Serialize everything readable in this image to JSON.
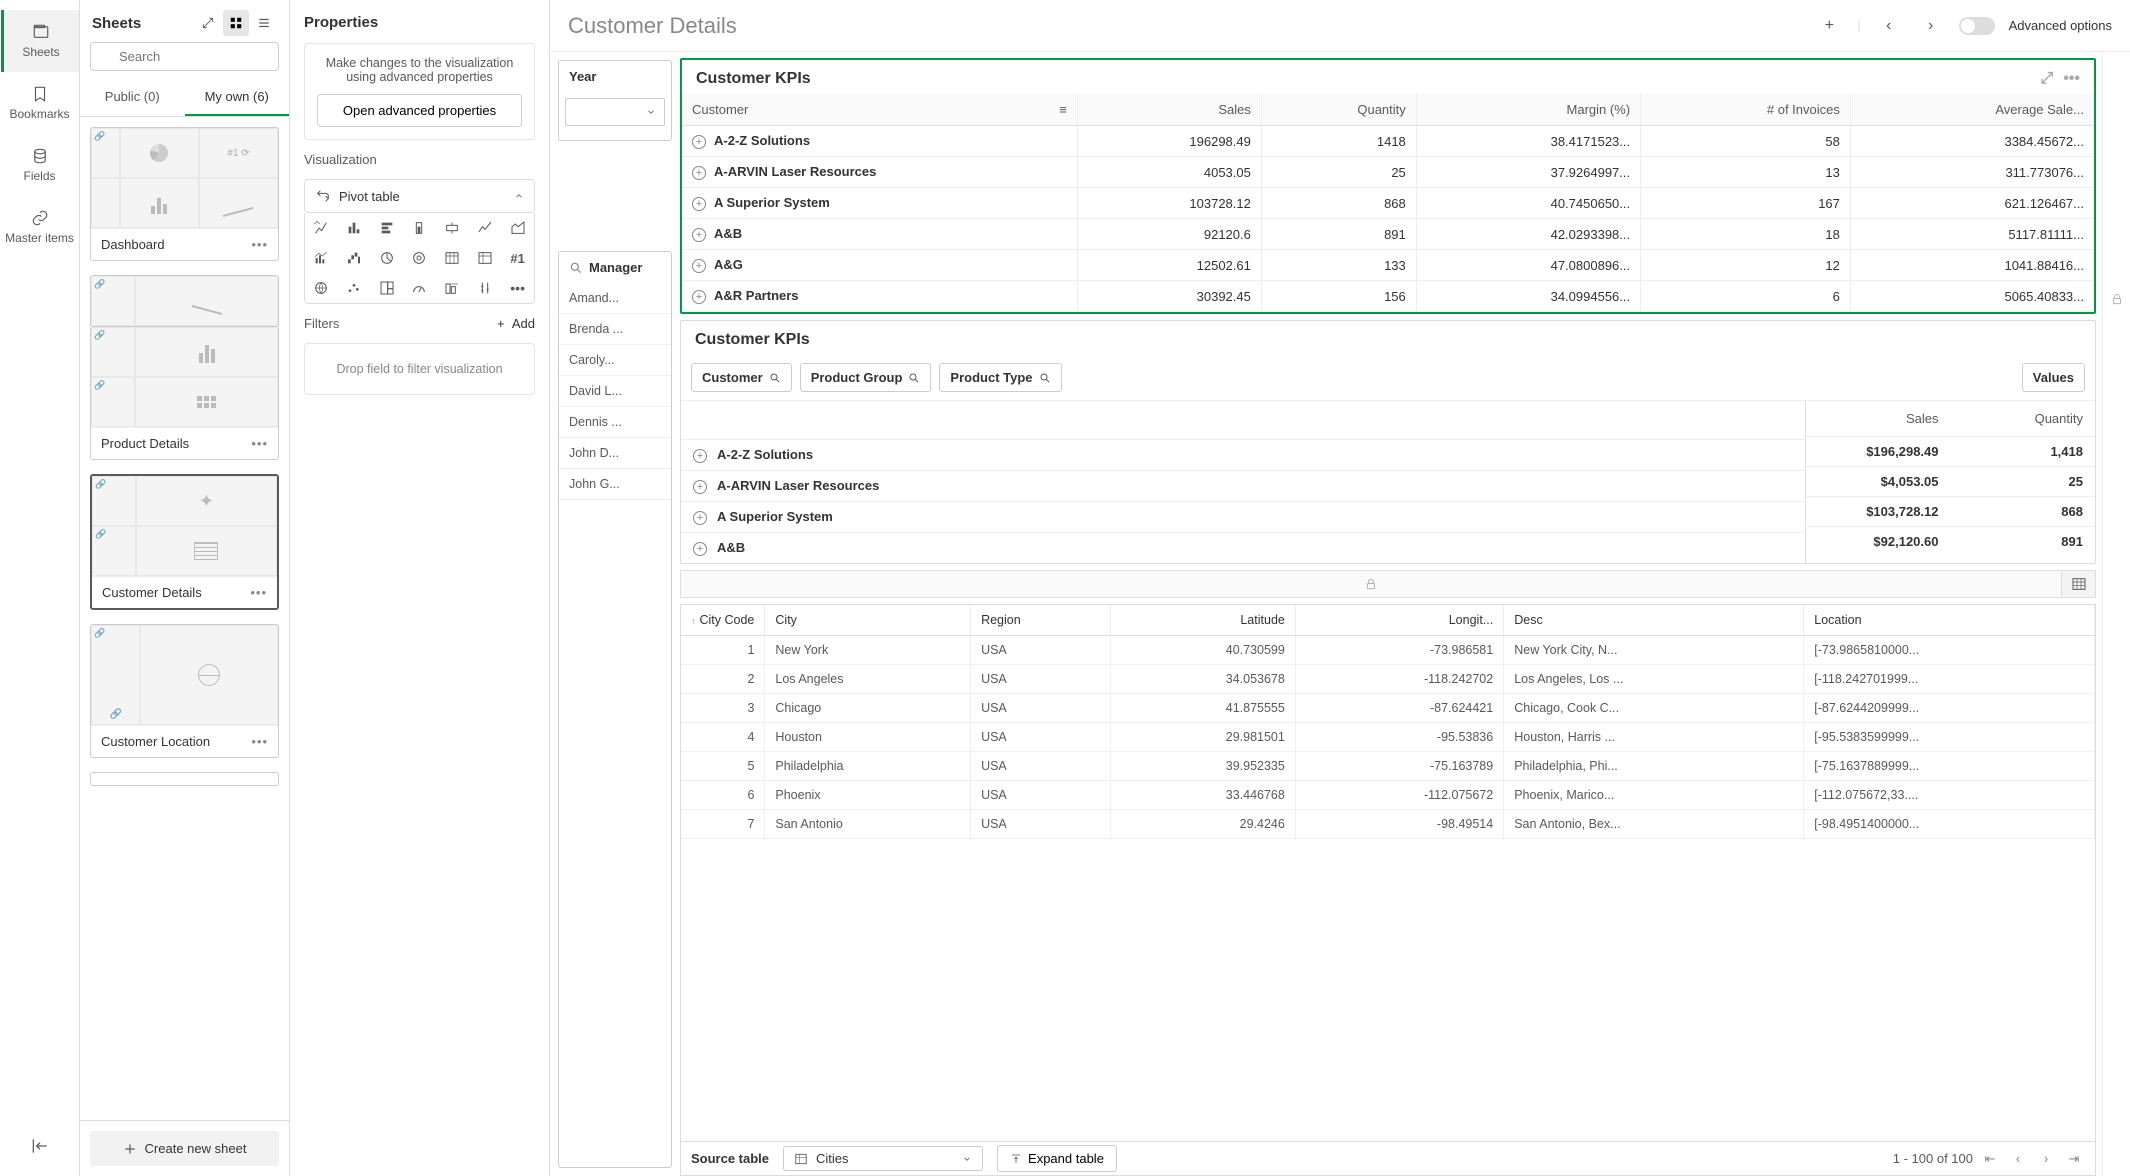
{
  "rail": {
    "sheets": "Sheets",
    "bookmarks": "Bookmarks",
    "fields": "Fields",
    "master": "Master items"
  },
  "sheets": {
    "title": "Sheets",
    "searchPlaceholder": "Search",
    "tabs": {
      "public": "Public (0)",
      "myown": "My own (6)"
    },
    "items": [
      {
        "name": "Dashboard"
      },
      {
        "name": "Product Details"
      },
      {
        "name": "Customer Details"
      },
      {
        "name": "Customer Location"
      }
    ],
    "createLabel": "Create new sheet"
  },
  "props": {
    "title": "Properties",
    "advText": "Make changes to the visualization using advanced properties",
    "advBtn": "Open advanced properties",
    "vizLabel": "Visualization",
    "vizName": "Pivot table",
    "filtersLabel": "Filters",
    "addLabel": "Add",
    "dropText": "Drop field to filter visualization"
  },
  "main": {
    "title": "Customer Details",
    "advOptions": "Advanced options"
  },
  "filters": {
    "year": "Year",
    "managerTitle": "Manager",
    "managers": [
      "Amand...",
      "Brenda ...",
      "Caroly...",
      "David L...",
      "Dennis ...",
      "John D...",
      "John G..."
    ]
  },
  "kpi1": {
    "title": "Customer KPIs",
    "cols": {
      "customer": "Customer",
      "sales": "Sales",
      "quantity": "Quantity",
      "margin": "Margin (%)",
      "invoices": "# of Invoices",
      "avg": "Average Sale..."
    },
    "rows": [
      {
        "customer": "A-2-Z Solutions",
        "sales": "196298.49",
        "quantity": "1418",
        "margin": "38.4171523...",
        "invoices": "58",
        "avg": "3384.45672..."
      },
      {
        "customer": "A-ARVIN Laser Resources",
        "sales": "4053.05",
        "quantity": "25",
        "margin": "37.9264997...",
        "invoices": "13",
        "avg": "311.773076..."
      },
      {
        "customer": "A Superior System",
        "sales": "103728.12",
        "quantity": "868",
        "margin": "40.7450650...",
        "invoices": "167",
        "avg": "621.126467..."
      },
      {
        "customer": "A&B",
        "sales": "92120.6",
        "quantity": "891",
        "margin": "42.0293398...",
        "invoices": "18",
        "avg": "5117.81111..."
      },
      {
        "customer": "A&G",
        "sales": "12502.61",
        "quantity": "133",
        "margin": "47.0800896...",
        "invoices": "12",
        "avg": "1041.88416..."
      },
      {
        "customer": "A&R Partners",
        "sales": "30392.45",
        "quantity": "156",
        "margin": "34.0994556...",
        "invoices": "6",
        "avg": "5065.40833..."
      }
    ]
  },
  "kpi2": {
    "title": "Customer KPIs",
    "chips": {
      "customer": "Customer",
      "productGroup": "Product Group",
      "productType": "Product Type",
      "values": "Values"
    },
    "cols": {
      "sales": "Sales",
      "quantity": "Quantity"
    },
    "rows": [
      {
        "customer": "A-2-Z Solutions",
        "sales": "$196,298.49",
        "quantity": "1,418"
      },
      {
        "customer": "A-ARVIN Laser Resources",
        "sales": "$4,053.05",
        "quantity": "25"
      },
      {
        "customer": "A Superior System",
        "sales": "$103,728.12",
        "quantity": "868"
      },
      {
        "customer": "A&B",
        "sales": "$92,120.60",
        "quantity": "891"
      }
    ]
  },
  "table": {
    "cols": {
      "code": "City Code",
      "city": "City",
      "region": "Region",
      "lat": "Latitude",
      "lon": "Longit...",
      "desc": "Desc",
      "loc": "Location"
    },
    "rows": [
      {
        "code": "1",
        "city": "New York",
        "region": "USA",
        "lat": "40.730599",
        "lon": "-73.986581",
        "desc": "New York City, N...",
        "loc": "[-73.9865810000..."
      },
      {
        "code": "2",
        "city": "Los Angeles",
        "region": "USA",
        "lat": "34.053678",
        "lon": "-118.242702",
        "desc": "Los Angeles, Los ...",
        "loc": "[-118.242701999..."
      },
      {
        "code": "3",
        "city": "Chicago",
        "region": "USA",
        "lat": "41.875555",
        "lon": "-87.624421",
        "desc": "Chicago, Cook C...",
        "loc": "[-87.6244209999..."
      },
      {
        "code": "4",
        "city": "Houston",
        "region": "USA",
        "lat": "29.981501",
        "lon": "-95.53836",
        "desc": "Houston, Harris ...",
        "loc": "[-95.5383599999..."
      },
      {
        "code": "5",
        "city": "Philadelphia",
        "region": "USA",
        "lat": "39.952335",
        "lon": "-75.163789",
        "desc": "Philadelphia, Phi...",
        "loc": "[-75.1637889999..."
      },
      {
        "code": "6",
        "city": "Phoenix",
        "region": "USA",
        "lat": "33.446768",
        "lon": "-112.075672",
        "desc": "Phoenix, Marico...",
        "loc": "[-112.075672,33...."
      },
      {
        "code": "7",
        "city": "San Antonio",
        "region": "USA",
        "lat": "29.4246",
        "lon": "-98.49514",
        "desc": "San Antonio, Bex...",
        "loc": "[-98.4951400000..."
      }
    ]
  },
  "source": {
    "label": "Source table",
    "selected": "Cities",
    "expand": "Expand table",
    "pageText": "1 - 100 of 100"
  }
}
